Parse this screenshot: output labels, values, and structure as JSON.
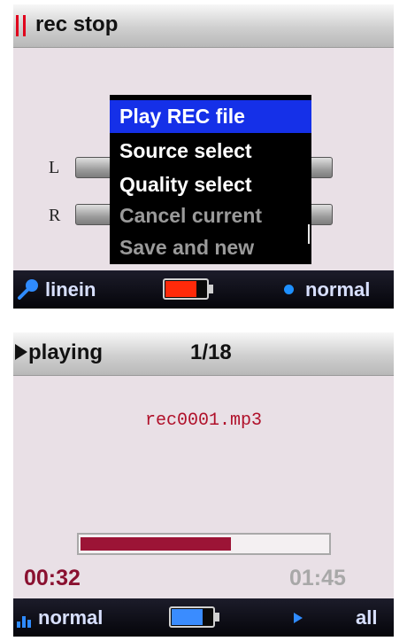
{
  "colors": {
    "screen_bg": "#e9e0e6",
    "menu_bg": "#000000",
    "menu_selected": "#1530e8",
    "menu_disabled": "#9a9a9a",
    "record_accent": "#e0001c",
    "filename_color": "#b0102a",
    "progress_fill": "#9c1436",
    "elapsed_color": "#8a1030",
    "total_color": "#a8a8a8",
    "status_text": "#d8e0ff",
    "status_icon_blue": "#2f8bff",
    "battery_red": "#ff2a0a",
    "battery_blue": "#3a8cff"
  },
  "record_screen": {
    "title_icon": "pause-icon",
    "title": "rec stop",
    "meters": {
      "left_label": "L",
      "right_label": "R"
    },
    "menu": {
      "items": [
        {
          "label": "Play REC file",
          "state": "selected"
        },
        {
          "label": "Source select",
          "state": "enabled"
        },
        {
          "label": "Quality select",
          "state": "enabled"
        },
        {
          "label": "Cancel current",
          "state": "disabled"
        },
        {
          "label": "Save and new",
          "state": "disabled"
        }
      ]
    },
    "status": {
      "source_icon": "microphone-icon",
      "source": "linein",
      "battery_icon": "battery-icon",
      "battery_level": 0.8,
      "quality_icon": "dot-icon",
      "quality": "normal"
    }
  },
  "play_screen": {
    "title_icon": "play-icon",
    "title": "playing",
    "track_counter": "1/18",
    "filename": "rec0001.mp3",
    "progress": 0.61,
    "elapsed": "00:32",
    "total": "01:45",
    "status": {
      "eq_icon": "equalizer-icon",
      "eq": "normal",
      "battery_icon": "battery-icon",
      "battery_level": 0.8,
      "repeat_icon": "play-icon",
      "repeat": "all"
    }
  }
}
